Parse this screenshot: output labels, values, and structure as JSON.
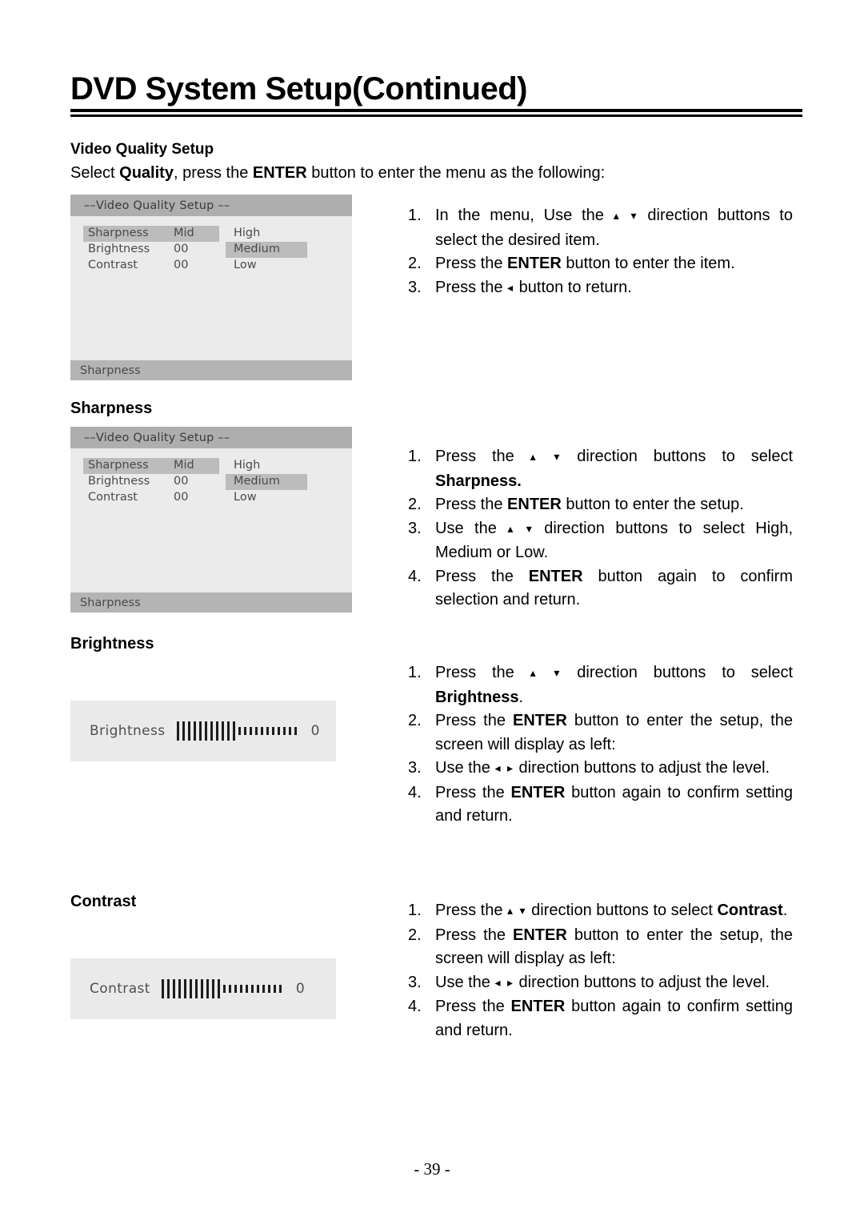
{
  "page": {
    "title": "DVD System Setup(Continued)",
    "number": "- 39 -"
  },
  "video_quality": {
    "heading": "Video Quality Setup",
    "intro_pre": "Select ",
    "intro_bold1": "Quality",
    "intro_mid": ", press the ",
    "intro_bold2": "ENTER",
    "intro_post": " button to enter the menu as the following:"
  },
  "osd_menu": {
    "title_bar": "––Video  Quality Setup ––",
    "footer_bar": "Sharpness",
    "rows": [
      {
        "label": "Sharpness",
        "value": "Mid",
        "highlight": true,
        "option": "High",
        "option_highlight": false
      },
      {
        "label": "Brightness",
        "value": "00",
        "highlight": false,
        "option": "Medium",
        "option_highlight": true
      },
      {
        "label": "Contrast",
        "value": "00",
        "highlight": false,
        "option": "Low",
        "option_highlight": false
      }
    ]
  },
  "sections": {
    "sharpness_heading": "Sharpness",
    "brightness_heading": "Brightness",
    "contrast_heading": "Contrast"
  },
  "sliders": {
    "brightness": {
      "label": "Brightness",
      "value": "0",
      "filled_bars": 11,
      "empty_bars": 11
    },
    "contrast": {
      "label": "Contrast",
      "value": "0",
      "filled_bars": 11,
      "empty_bars": 11
    }
  },
  "instructions_menu": {
    "items": [
      {
        "num": "1.",
        "html": "In the menu, Use the <span class=\"arrow\">▴ ▾</span> direction buttons to select the desired item."
      },
      {
        "num": "2.",
        "html": "Press the <b>ENTER</b> button to enter the item."
      },
      {
        "num": "3.",
        "html": "Press the <span class=\"arrow\">◂</span> button to return."
      }
    ]
  },
  "instructions_sharpness": {
    "items": [
      {
        "num": "1.",
        "html": "Press the <span class=\"arrow\">▴ ▾</span> direction buttons to select <b>Sharpness.</b>"
      },
      {
        "num": "2.",
        "html": "Press the <b>ENTER</b> button to enter the setup."
      },
      {
        "num": "3.",
        "html": "Use the <span class=\"arrow\">▴ ▾</span> direction buttons to select High, Medium or Low."
      },
      {
        "num": "4.",
        "html": "Press the <b>ENTER</b> button again to confirm selection and return."
      }
    ]
  },
  "instructions_brightness": {
    "items": [
      {
        "num": "1.",
        "html": "Press the <span class=\"arrow\">▴ ▾</span> direction buttons to select <b>Brightness</b>."
      },
      {
        "num": "2.",
        "html": "Press the <b>ENTER</b> button to enter the setup, the screen will display as left:"
      },
      {
        "num": "3.",
        "html": "Use the <span class=\"arrow\">◂ ▸</span> direction buttons to adjust the level."
      },
      {
        "num": "4.",
        "html": "Press the <b>ENTER</b> button again to confirm setting and return."
      }
    ]
  },
  "instructions_contrast": {
    "items": [
      {
        "num": "1.",
        "html": "Press the <span class=\"arrow\">▴ ▾</span> direction buttons to select <b>Contrast</b>."
      },
      {
        "num": "2.",
        "html": "Press the <b>ENTER</b> button to enter the setup, the screen will display as left:"
      },
      {
        "num": "3.",
        "html": "Use the <span class=\"arrow\">◂ ▸</span> direction buttons to adjust the level."
      },
      {
        "num": "4.",
        "html": "Press the <b>ENTER</b> button again to confirm setting and return."
      }
    ]
  }
}
